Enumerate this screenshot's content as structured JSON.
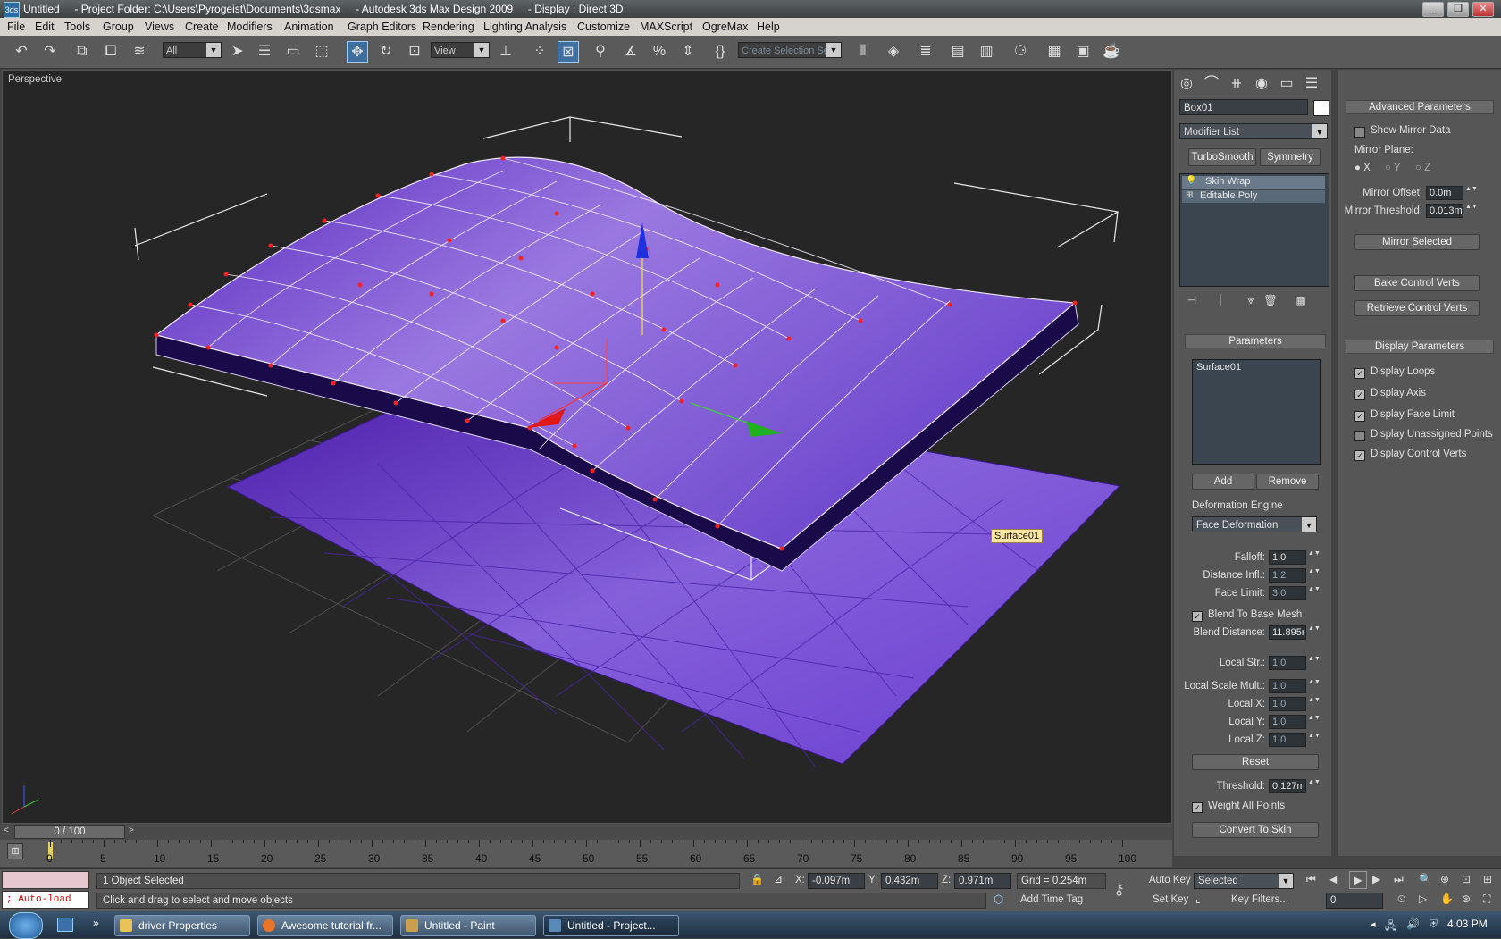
{
  "window": {
    "title": "Untitled     - Project Folder: C:\\Users\\Pyrogeist\\Documents\\3dsmax     - Autodesk 3ds Max Design 2009     - Display : Direct 3D",
    "app_icon": "3ds"
  },
  "menu": [
    "File",
    "Edit",
    "Tools",
    "Group",
    "Views",
    "Create",
    "Modifiers",
    "Animation",
    "Graph Editors",
    "Rendering",
    "Lighting Analysis",
    "Customize",
    "MAXScript",
    "OgreMax",
    "Help"
  ],
  "toolbar": {
    "selection_filter": "All",
    "ref_coord": "View",
    "named_selection_placeholder": "Create Selection Se"
  },
  "viewport": {
    "label": "Perspective",
    "object_tag": "Surface01",
    "colors": {
      "mesh": "#7a4bd6",
      "verts": "#ff2020",
      "bg": "#262626"
    }
  },
  "command_panel": {
    "object_name": "Box01",
    "modifier_list": "Modifier List",
    "quick_buttons": [
      "TurboSmooth",
      "Symmetry"
    ],
    "stack": [
      "Skin Wrap",
      "Editable Poly"
    ],
    "parameters": {
      "header": "Parameters",
      "list_items": [
        "Surface01"
      ],
      "add": "Add",
      "remove": "Remove",
      "deformation_engine_label": "Deformation Engine",
      "deformation_engine": "Face Deformation",
      "falloff_label": "Falloff:",
      "falloff": "1.0",
      "distance_label": "Distance Infl.:",
      "distance": "1.2",
      "face_limit_label": "Face Limit:",
      "face_limit": "3.0",
      "blend_label": "Blend To Base Mesh",
      "blend_distance_label": "Blend Distance:",
      "blend_distance": "11.895r",
      "local_str_label": "Local Str.:",
      "local_str": "1.0",
      "local_scale_label": "Local Scale Mult.:",
      "local_scale": "1.0",
      "local_x_label": "Local X:",
      "local_x": "1.0",
      "local_y_label": "Local Y:",
      "local_y": "1.0",
      "local_z_label": "Local Z:",
      "local_z": "1.0",
      "reset": "Reset",
      "threshold_label": "Threshold:",
      "threshold": "0.127m",
      "weight_all_label": "Weight All Points",
      "convert": "Convert To Skin"
    }
  },
  "advanced_panel": {
    "header": "Advanced Parameters",
    "show_mirror": "Show Mirror Data",
    "mirror_plane_label": "Mirror Plane:",
    "axes": [
      "X",
      "Y",
      "Z"
    ],
    "mirror_offset_label": "Mirror Offset:",
    "mirror_offset": "0.0m",
    "mirror_threshold_label": "Mirror Threshold:",
    "mirror_threshold": "0.013m",
    "mirror_selected": "Mirror Selected",
    "bake": "Bake Control Verts",
    "retrieve": "Retrieve Control Verts",
    "display_header": "Display Parameters",
    "display_items": [
      "Display Loops",
      "Display Axis",
      "Display Face Limit",
      "Display Unassigned Points",
      "Display Control Verts"
    ]
  },
  "timeline": {
    "frame": "0 / 100",
    "ticks": [
      "0",
      "5",
      "10",
      "15",
      "20",
      "25",
      "30",
      "35",
      "40",
      "45",
      "50",
      "55",
      "60",
      "65",
      "70",
      "75",
      "80",
      "85",
      "90",
      "95",
      "100"
    ]
  },
  "status": {
    "maxscript": "; Auto-load",
    "selected": "1 Object Selected",
    "prompt": "Click and drag to select and move objects",
    "x": "-0.097m",
    "y": "0.432m",
    "z": "0.971m",
    "grid": "Grid = 0.254m",
    "add_time_tag": "Add Time Tag",
    "auto_key": "Auto Key",
    "set_key": "Set Key",
    "key_mode": "Selected",
    "key_filters": "Key Filters...",
    "current_frame": "0"
  },
  "taskbar": {
    "tasks": [
      "driver Properties",
      "Awesome tutorial fr...",
      "Untitled - Paint",
      "Untitled     - Project..."
    ],
    "clock": "4:03 PM"
  }
}
